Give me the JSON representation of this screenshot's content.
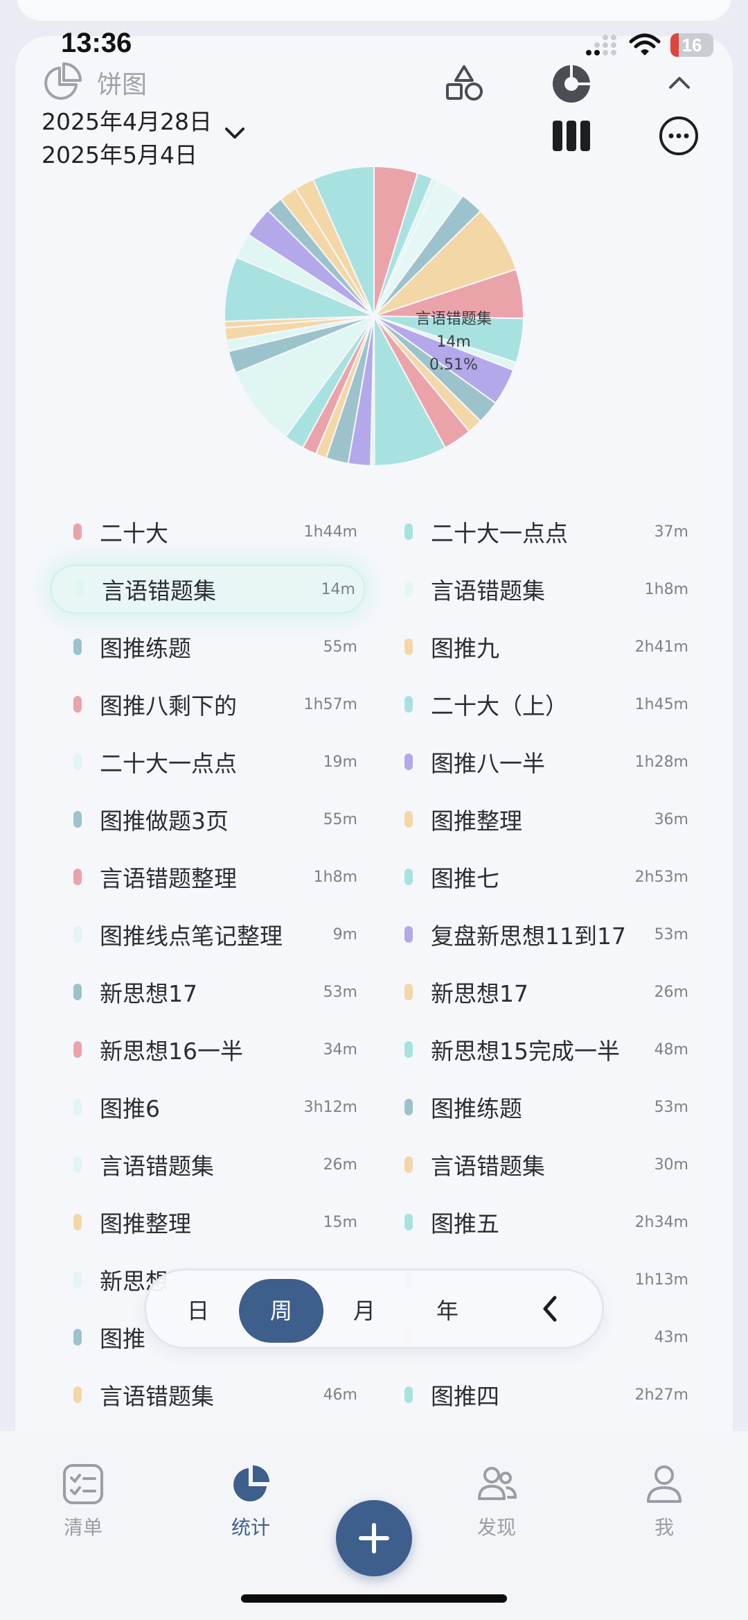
{
  "status": {
    "time": "13:36",
    "battery": "16"
  },
  "header": {
    "title": "饼图",
    "date_start": "2025年4月28日",
    "date_end": "2025年5月4日"
  },
  "pie_tooltip": {
    "name": "言语错题集",
    "duration": "14m",
    "percent": "0.51%"
  },
  "chart_data": {
    "type": "pie",
    "title": "",
    "slices": [
      {
        "name": "二十大",
        "value": 104,
        "color": "#eba3aa"
      },
      {
        "name": "二十大一点点",
        "value": 37,
        "color": "#a8e2e0"
      },
      {
        "name": "言语错题集",
        "value": 14,
        "color": "#dff6f3"
      },
      {
        "name": "言语错题集",
        "value": 68,
        "color": "#e4f7f5"
      },
      {
        "name": "图推练题",
        "value": 55,
        "color": "#9cc3cc"
      },
      {
        "name": "图推九",
        "value": 161,
        "color": "#f4d7a6"
      },
      {
        "name": "图推八剩下的",
        "value": 117,
        "color": "#eba3aa"
      },
      {
        "name": "二十大（上）",
        "value": 105,
        "color": "#a8e2e0"
      },
      {
        "name": "二十大一点点",
        "value": 19,
        "color": "#dff6f3"
      },
      {
        "name": "图推八一半",
        "value": 88,
        "color": "#b3a8ea"
      },
      {
        "name": "图推做题3页",
        "value": 55,
        "color": "#9cc3cc"
      },
      {
        "name": "图推整理",
        "value": 36,
        "color": "#f4d7a6"
      },
      {
        "name": "言语错题整理",
        "value": 68,
        "color": "#eba3aa"
      },
      {
        "name": "图推七",
        "value": 173,
        "color": "#a8e2e0"
      },
      {
        "name": "图推线点笔记整理",
        "value": 9,
        "color": "#dff6f3"
      },
      {
        "name": "复盘新思想11到17",
        "value": 53,
        "color": "#b3a8ea"
      },
      {
        "name": "新思想17",
        "value": 53,
        "color": "#9cc3cc"
      },
      {
        "name": "新思想17",
        "value": 26,
        "color": "#f4d7a6"
      },
      {
        "name": "新思想16一半",
        "value": 34,
        "color": "#eba3aa"
      },
      {
        "name": "新思想15完成一半",
        "value": 48,
        "color": "#a8e2e0"
      },
      {
        "name": "图推6",
        "value": 192,
        "color": "#dff6f3"
      },
      {
        "name": "图推练题",
        "value": 53,
        "color": "#9cc3cc"
      },
      {
        "name": "言语错题集",
        "value": 26,
        "color": "#dff6f3"
      },
      {
        "name": "言语错题集",
        "value": 30,
        "color": "#f4d7a6"
      },
      {
        "name": "图推整理",
        "value": 15,
        "color": "#f4d7a6"
      },
      {
        "name": "图推五",
        "value": 154,
        "color": "#a8e2e0"
      },
      {
        "name": "新思想",
        "value": 60,
        "color": "#dff6f3"
      },
      {
        "name": "",
        "value": 73,
        "color": "#b3a8ea"
      },
      {
        "name": "图推",
        "value": 40,
        "color": "#9cc3cc"
      },
      {
        "name": "",
        "value": 43,
        "color": "#f4d7a6"
      },
      {
        "name": "言语错题集",
        "value": 46,
        "color": "#f4d7a6"
      },
      {
        "name": "图推四",
        "value": 147,
        "color": "#a8e2e0"
      }
    ]
  },
  "legend": {
    "rows": [
      {
        "l": {
          "name": "二十大",
          "dur": "1h44m",
          "color": "#eba3aa"
        },
        "r": {
          "name": "二十大一点点",
          "dur": "37m",
          "color": "#a8e2e0"
        }
      },
      {
        "l": {
          "name": "言语错题集",
          "dur": "14m",
          "color": "#dff6f3"
        },
        "r": {
          "name": "言语错题集",
          "dur": "1h8m",
          "color": "#e4f7f5"
        }
      },
      {
        "l": {
          "name": "图推练题",
          "dur": "55m",
          "color": "#9cc3cc"
        },
        "r": {
          "name": "图推九",
          "dur": "2h41m",
          "color": "#f4d7a6"
        }
      },
      {
        "l": {
          "name": "图推八剩下的",
          "dur": "1h57m",
          "color": "#eba3aa"
        },
        "r": {
          "name": "二十大（上）",
          "dur": "1h45m",
          "color": "#a8e2e0"
        }
      },
      {
        "l": {
          "name": "二十大一点点",
          "dur": "19m",
          "color": "#dff6f3"
        },
        "r": {
          "name": "图推八一半",
          "dur": "1h28m",
          "color": "#b3a8ea"
        }
      },
      {
        "l": {
          "name": "图推做题3页",
          "dur": "55m",
          "color": "#9cc3cc"
        },
        "r": {
          "name": "图推整理",
          "dur": "36m",
          "color": "#f4d7a6"
        }
      },
      {
        "l": {
          "name": "言语错题整理",
          "dur": "1h8m",
          "color": "#eba3aa"
        },
        "r": {
          "name": "图推七",
          "dur": "2h53m",
          "color": "#a8e2e0"
        }
      },
      {
        "l": {
          "name": "图推线点笔记整理",
          "dur": "9m",
          "color": "#dff6f3"
        },
        "r": {
          "name": "复盘新思想11到17",
          "dur": "53m",
          "color": "#b3a8ea"
        }
      },
      {
        "l": {
          "name": "新思想17",
          "dur": "53m",
          "color": "#9cc3cc"
        },
        "r": {
          "name": "新思想17",
          "dur": "26m",
          "color": "#f4d7a6"
        }
      },
      {
        "l": {
          "name": "新思想16一半",
          "dur": "34m",
          "color": "#eba3aa"
        },
        "r": {
          "name": "新思想15完成一半",
          "dur": "48m",
          "color": "#a8e2e0"
        }
      },
      {
        "l": {
          "name": "图推6",
          "dur": "3h12m",
          "color": "#dff6f3"
        },
        "r": {
          "name": "图推练题",
          "dur": "53m",
          "color": "#9cc3cc"
        }
      },
      {
        "l": {
          "name": "言语错题集",
          "dur": "26m",
          "color": "#dff6f3"
        },
        "r": {
          "name": "言语错题集",
          "dur": "30m",
          "color": "#f4d7a6"
        }
      },
      {
        "l": {
          "name": "图推整理",
          "dur": "15m",
          "color": "#f4d7a6"
        },
        "r": {
          "name": "图推五",
          "dur": "2h34m",
          "color": "#a8e2e0"
        }
      },
      {
        "l": {
          "name": "新思想",
          "dur": "",
          "color": "#dff6f3"
        },
        "r": {
          "name": "",
          "dur": "1h13m",
          "color": "#b3a8ea"
        }
      },
      {
        "l": {
          "name": "图推",
          "dur": "",
          "color": "#9cc3cc"
        },
        "r": {
          "name": "",
          "dur": "43m",
          "color": "#f4d7a6"
        }
      },
      {
        "l": {
          "name": "言语错题集",
          "dur": "46m",
          "color": "#f4d7a6"
        },
        "r": {
          "name": "图推四",
          "dur": "2h27m",
          "color": "#a8e2e0"
        }
      }
    ]
  },
  "range": {
    "day": "日",
    "week": "周",
    "month": "月",
    "year": "年",
    "active": "week"
  },
  "tabbar": {
    "list": "清单",
    "stats": "统计",
    "discover": "发现",
    "me": "我"
  },
  "colors": {
    "accent": "#3e5e8c"
  }
}
